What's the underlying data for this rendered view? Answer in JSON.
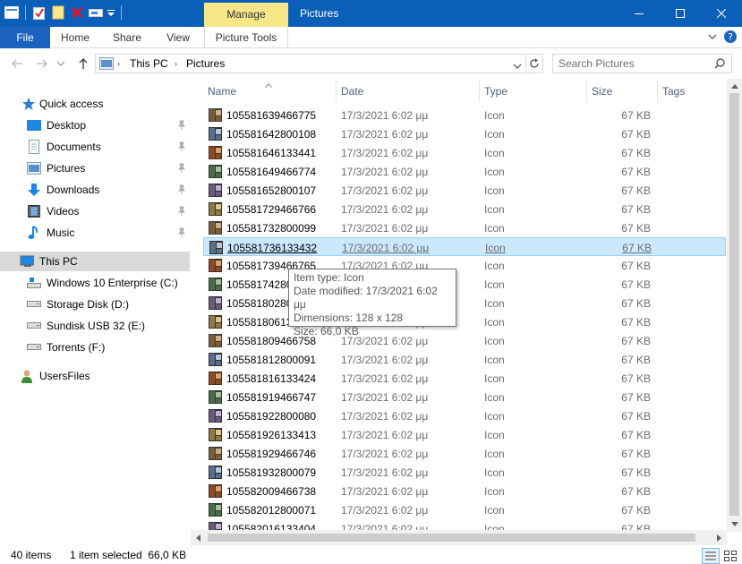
{
  "titlebar": {
    "manage_tab": "Manage",
    "title": "Pictures",
    "bg_color": "#0b5fb8",
    "manage_color": "#f7e788"
  },
  "ribbon": {
    "tabs": [
      "File",
      "Home",
      "Share",
      "View",
      "Picture Tools"
    ]
  },
  "address": {
    "crumbs": [
      "This PC",
      "Pictures"
    ],
    "search_placeholder": "Search Pictures"
  },
  "nav": {
    "quick_access": "Quick access",
    "quick_items": [
      "Desktop",
      "Documents",
      "Pictures",
      "Downloads",
      "Videos",
      "Music"
    ],
    "this_pc": "This PC",
    "drives": [
      "Windows 10 Enterprise (C:)",
      "Storage Disk (D:)",
      "Sundisk USB 32 (E:)",
      "Torrents (F:)"
    ],
    "users_files": "UsersFiles"
  },
  "columns": {
    "name": "Name",
    "date": "Date",
    "type": "Type",
    "size": "Size",
    "tags": "Tags"
  },
  "files": [
    {
      "name": "105581639466775",
      "date": "17/3/2021 6:02 μμ",
      "type": "Icon",
      "size": "67 KB"
    },
    {
      "name": "105581642800108",
      "date": "17/3/2021 6:02 μμ",
      "type": "Icon",
      "size": "67 KB"
    },
    {
      "name": "105581646133441",
      "date": "17/3/2021 6:02 μμ",
      "type": "Icon",
      "size": "67 KB"
    },
    {
      "name": "105581649466774",
      "date": "17/3/2021 6:02 μμ",
      "type": "Icon",
      "size": "67 KB"
    },
    {
      "name": "105581652800107",
      "date": "17/3/2021 6:02 μμ",
      "type": "Icon",
      "size": "67 KB"
    },
    {
      "name": "105581729466766",
      "date": "17/3/2021 6:02 μμ",
      "type": "Icon",
      "size": "67 KB"
    },
    {
      "name": "105581732800099",
      "date": "17/3/2021 6:02 μμ",
      "type": "Icon",
      "size": "67 KB"
    },
    {
      "name": "105581736133432",
      "date": "17/3/2021 6:02 μμ",
      "type": "Icon",
      "size": "67 KB"
    },
    {
      "name": "105581739466765",
      "date": "17/3/2021 6:02 μμ",
      "type": "Icon",
      "size": "67 KB"
    },
    {
      "name": "105581742800098",
      "date": "17/3/2021 6:02 μμ",
      "type": "Icon",
      "size": "67 KB"
    },
    {
      "name": "105581802800092",
      "date": "17/3/2021 6:02 μμ",
      "type": "Icon",
      "size": "67 KB"
    },
    {
      "name": "105581806133425",
      "date": "17/3/2021 6:02 μμ",
      "type": "Icon",
      "size": "67 KB"
    },
    {
      "name": "105581809466758",
      "date": "17/3/2021 6:02 μμ",
      "type": "Icon",
      "size": "67 KB"
    },
    {
      "name": "105581812800091",
      "date": "17/3/2021 6:02 μμ",
      "type": "Icon",
      "size": "67 KB"
    },
    {
      "name": "105581816133424",
      "date": "17/3/2021 6:02 μμ",
      "type": "Icon",
      "size": "67 KB"
    },
    {
      "name": "105581919466747",
      "date": "17/3/2021 6:02 μμ",
      "type": "Icon",
      "size": "67 KB"
    },
    {
      "name": "105581922800080",
      "date": "17/3/2021 6:02 μμ",
      "type": "Icon",
      "size": "67 KB"
    },
    {
      "name": "105581926133413",
      "date": "17/3/2021 6:02 μμ",
      "type": "Icon",
      "size": "67 KB"
    },
    {
      "name": "105581929466746",
      "date": "17/3/2021 6:02 μμ",
      "type": "Icon",
      "size": "67 KB"
    },
    {
      "name": "105581932800079",
      "date": "17/3/2021 6:02 μμ",
      "type": "Icon",
      "size": "67 KB"
    },
    {
      "name": "105582009466738",
      "date": "17/3/2021 6:02 μμ",
      "type": "Icon",
      "size": "67 KB"
    },
    {
      "name": "105582012800071",
      "date": "17/3/2021 6:02 μμ",
      "type": "Icon",
      "size": "67 KB"
    },
    {
      "name": "105582016133404",
      "date": "17/3/2021 6:02 μμ",
      "type": "Icon",
      "size": "67 KB"
    }
  ],
  "selected_index": 7,
  "tooltip": {
    "item_type": "Item type: Icon",
    "date_modified": "Date modified: 17/3/2021 6:02 μμ",
    "dimensions": "Dimensions: 128 x 128",
    "size": "Size: 66,0 KB"
  },
  "status": {
    "items": "40 items",
    "selected": "1 item selected  66,0 KB"
  },
  "icons": {
    "folder": "folder-icon",
    "pin": "pin-icon",
    "drive": "drive-icon"
  }
}
